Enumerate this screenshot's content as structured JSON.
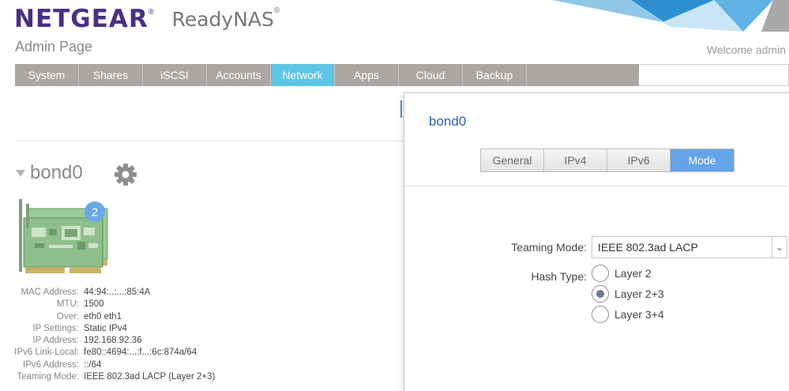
{
  "header": {
    "brand": "NETGEAR",
    "brand_mark": "®",
    "product": "ReadyNAS",
    "product_mark": "®",
    "page_title": "Admin Page",
    "welcome": "Welcome admin"
  },
  "nav": {
    "tabs": [
      "System",
      "Shares",
      "iSCSI",
      "Accounts",
      "Network",
      "Apps",
      "Cloud",
      "Backup"
    ],
    "active": "Network"
  },
  "interface": {
    "name": "bond0",
    "badge_count": "2",
    "details": [
      {
        "label": "MAC Address:",
        "value": "44:94:..:...:85:4A"
      },
      {
        "label": "MTU:",
        "value": "1500"
      },
      {
        "label": "Over:",
        "value": "eth0 eth1"
      },
      {
        "label": "IP Settings:",
        "value": "Static IPv4"
      },
      {
        "label": "IP Address:",
        "value": "192.168.92.36"
      },
      {
        "label": "IPv6 Link-Local:",
        "value": "fe80::4694:...:f...:6c:874a/64"
      },
      {
        "label": "IPv6 Address:",
        "value": "::/64"
      },
      {
        "label": "Teaming Mode:",
        "value": "IEEE 802.3ad LACP (Layer 2+3)"
      }
    ]
  },
  "dialog": {
    "title": "bond0",
    "tabs": [
      "General",
      "IPv4",
      "IPv6",
      "Mode"
    ],
    "active_tab": "Mode",
    "teaming_mode_label": "Teaming Mode:",
    "teaming_mode_value": "IEEE 802.3ad LACP",
    "hash_type_label": "Hash Type:",
    "hash_options": [
      "Layer 2",
      "Layer 2+3",
      "Layer 3+4"
    ],
    "hash_selected": "Layer 2+3"
  },
  "colors": {
    "brand": "#4a2f82",
    "nav_bg": "#aca7a1",
    "nav_active": "#5cc6e4",
    "tab_active": "#63a4ea",
    "badge": "#6aa8e8",
    "card_green": "#8fbf8a"
  },
  "icons": {
    "gear": "gear-icon",
    "caret": "caret-down-icon",
    "select": "chevron-down-icon",
    "card": "network-card-icon"
  }
}
